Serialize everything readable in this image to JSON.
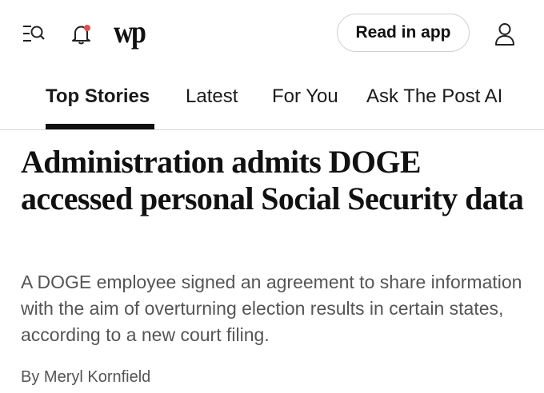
{
  "header": {
    "logo_text": "wp",
    "read_in_app_label": "Read in app",
    "notification_dot_color": "#e0504d",
    "icons": [
      "menu-search-icon",
      "bell-icon",
      "account-icon"
    ]
  },
  "tabs": [
    {
      "label": "Top Stories",
      "active": true
    },
    {
      "label": "Latest",
      "active": false
    },
    {
      "label": "For You",
      "active": false
    },
    {
      "label": "Ask The Post AI",
      "active": false
    }
  ],
  "article": {
    "headline": "Administration admits DOGE accessed personal Social Security data",
    "dek": "A DOGE employee signed an agreement to share information with the aim of overturning election results in certain states, according to a new court filing.",
    "byline_prefix": "By",
    "author": "Meryl Kornfield"
  }
}
